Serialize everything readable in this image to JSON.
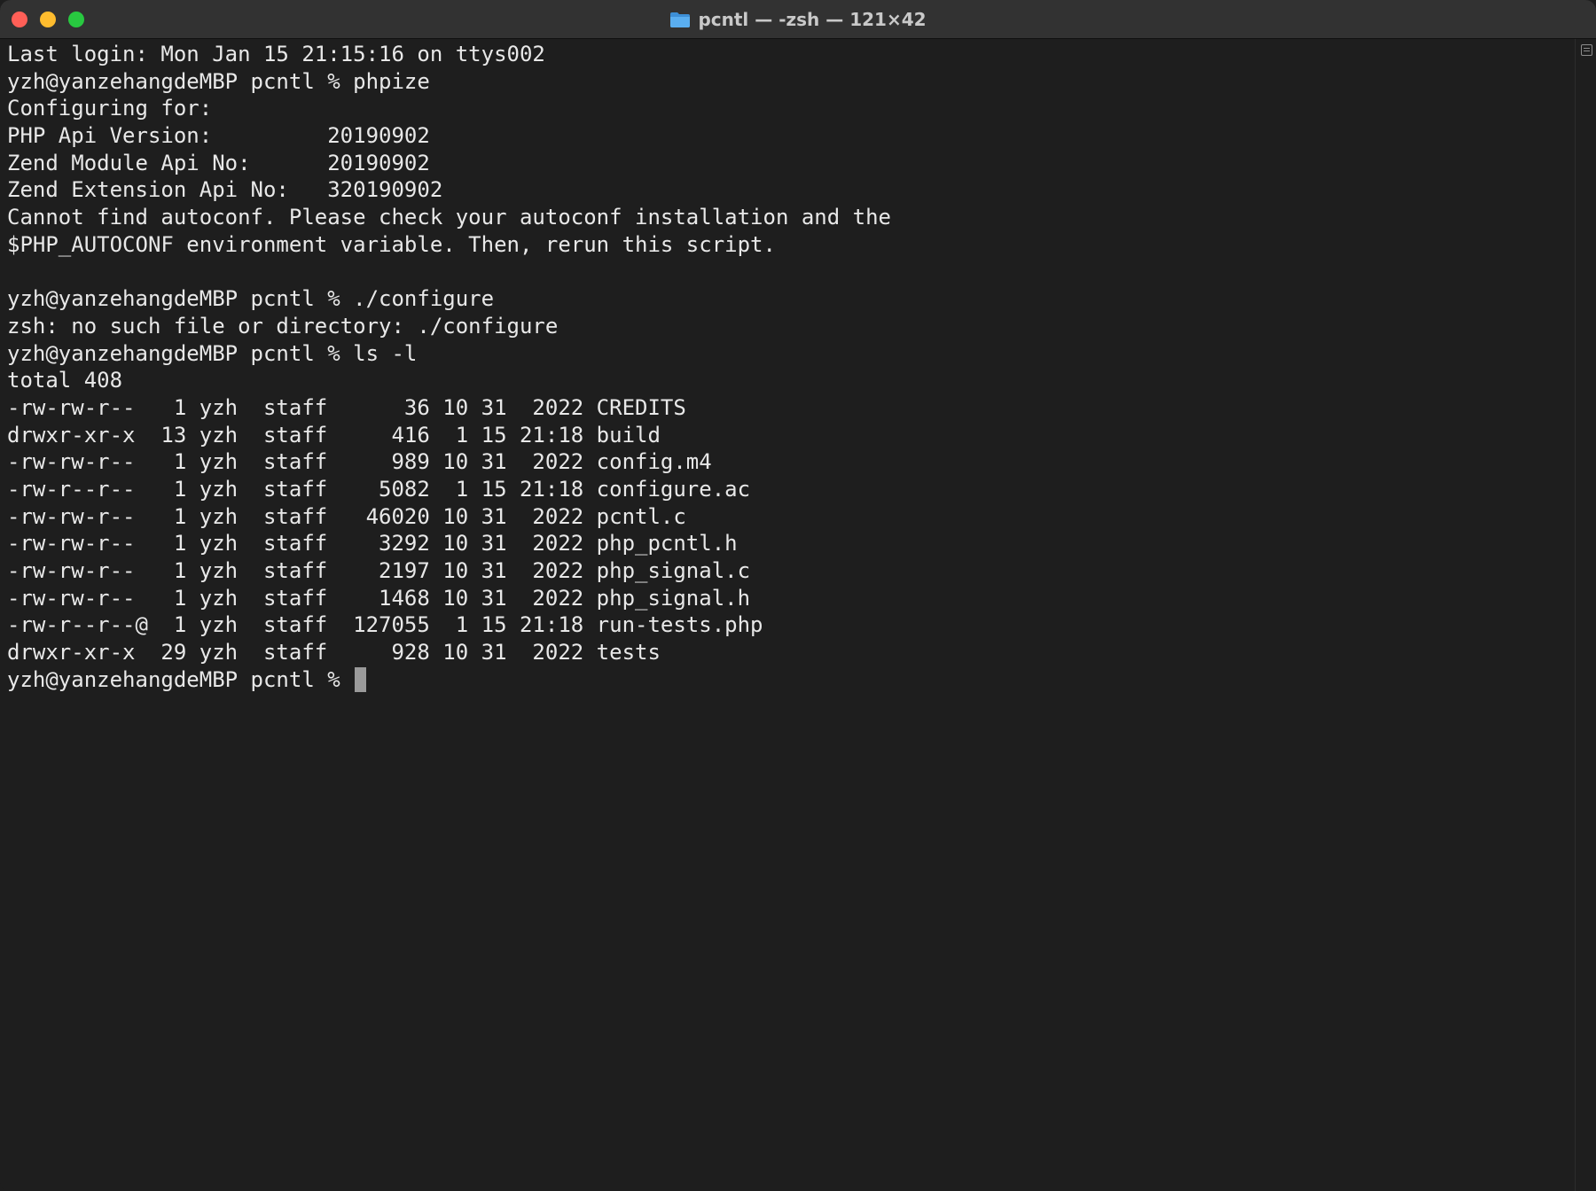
{
  "window": {
    "title": "pcntl — -zsh — 121×42"
  },
  "terminal": {
    "lines": [
      {
        "text": "Last login: Mon Jan 15 21:15:16 on ttys002",
        "prompt": false
      },
      {
        "text": "yzh@yanzehangdeMBP pcntl % phpize",
        "prompt": true
      },
      {
        "text": "Configuring for:",
        "prompt": false
      },
      {
        "text": "PHP Api Version:         20190902",
        "prompt": false
      },
      {
        "text": "Zend Module Api No:      20190902",
        "prompt": false
      },
      {
        "text": "Zend Extension Api No:   320190902",
        "prompt": false
      },
      {
        "text": "Cannot find autoconf. Please check your autoconf installation and the",
        "prompt": false
      },
      {
        "text": "$PHP_AUTOCONF environment variable. Then, rerun this script.",
        "prompt": false
      },
      {
        "text": "",
        "prompt": false
      },
      {
        "text": "yzh@yanzehangdeMBP pcntl % ./configure",
        "prompt": true
      },
      {
        "text": "zsh: no such file or directory: ./configure",
        "prompt": false
      },
      {
        "text": "yzh@yanzehangdeMBP pcntl % ls -l",
        "prompt": true
      },
      {
        "text": "total 408",
        "prompt": false
      },
      {
        "text": "-rw-rw-r--   1 yzh  staff      36 10 31  2022 CREDITS",
        "prompt": false
      },
      {
        "text": "drwxr-xr-x  13 yzh  staff     416  1 15 21:18 build",
        "prompt": false
      },
      {
        "text": "-rw-rw-r--   1 yzh  staff     989 10 31  2022 config.m4",
        "prompt": false
      },
      {
        "text": "-rw-r--r--   1 yzh  staff    5082  1 15 21:18 configure.ac",
        "prompt": false
      },
      {
        "text": "-rw-rw-r--   1 yzh  staff   46020 10 31  2022 pcntl.c",
        "prompt": false
      },
      {
        "text": "-rw-rw-r--   1 yzh  staff    3292 10 31  2022 php_pcntl.h",
        "prompt": false
      },
      {
        "text": "-rw-rw-r--   1 yzh  staff    2197 10 31  2022 php_signal.c",
        "prompt": false
      },
      {
        "text": "-rw-rw-r--   1 yzh  staff    1468 10 31  2022 php_signal.h",
        "prompt": false
      },
      {
        "text": "-rw-r--r--@  1 yzh  staff  127055  1 15 21:18 run-tests.php",
        "prompt": false
      },
      {
        "text": "drwxr-xr-x  29 yzh  staff     928 10 31  2022 tests",
        "prompt": false
      }
    ],
    "current_prompt": "yzh@yanzehangdeMBP pcntl % "
  },
  "colors": {
    "background": "#1e1e1e",
    "foreground": "#e8e8e8",
    "titlebar": "#323232",
    "close": "#ff5f57",
    "minimize": "#febc2e",
    "zoom": "#28c840",
    "folder": "#5aaef0"
  },
  "icons": {
    "title_icon": "folder-icon",
    "scrollbar_icon": "split-pane-icon"
  }
}
